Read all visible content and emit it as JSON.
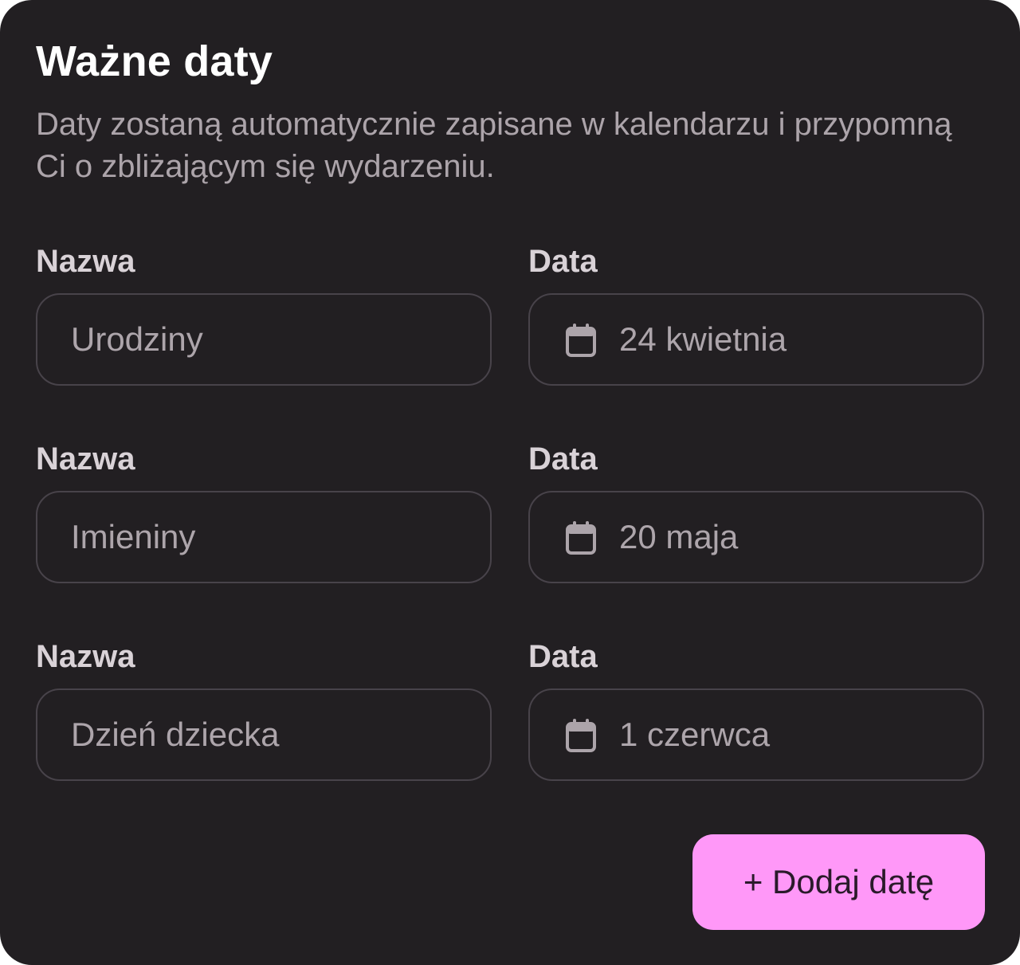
{
  "card": {
    "title": "Ważne daty",
    "description": "Daty zostaną automatycznie zapisane w kalendarzu i przypomną Ci o zbliżającym się wydarzeniu."
  },
  "rows": [
    {
      "name_label": "Nazwa",
      "name_value": "Urodziny",
      "date_label": "Data",
      "date_value": "24 kwietnia",
      "date_icon": "calendar-icon"
    },
    {
      "name_label": "Nazwa",
      "name_value": "Imieniny",
      "date_label": "Data",
      "date_value": "20 maja",
      "date_icon": "calendar-icon"
    },
    {
      "name_label": "Nazwa",
      "name_value": "Dzień dziecka",
      "date_label": "Data",
      "date_value": "1 czerwca",
      "date_icon": "calendar-icon"
    }
  ],
  "add_button": {
    "label": "+ Dodaj datę"
  },
  "colors": {
    "card_background": "#221f22",
    "field_border": "#48434a",
    "accent": "#ff98f8"
  }
}
